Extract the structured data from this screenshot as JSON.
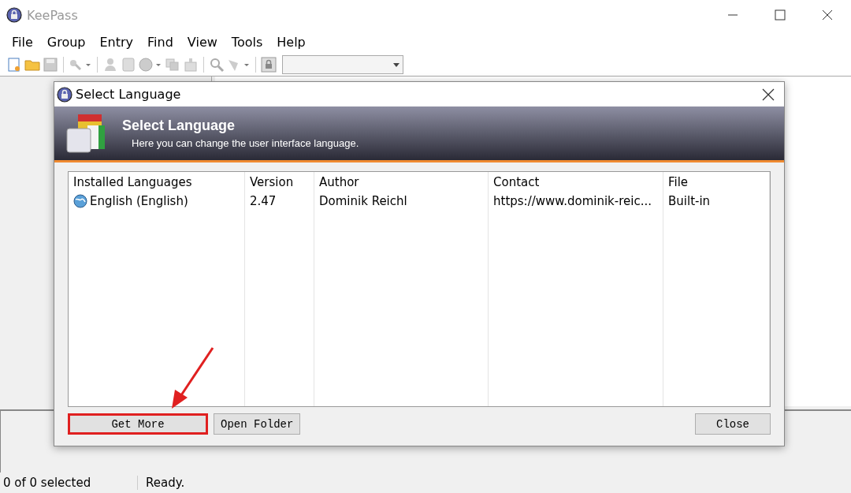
{
  "window": {
    "title": "KeePass"
  },
  "menu": [
    "File",
    "Group",
    "Entry",
    "Find",
    "View",
    "Tools",
    "Help"
  ],
  "dialog": {
    "title": "Select Language",
    "banner_title": "Select Language",
    "banner_subtitle": "Here you can change the user interface language.",
    "columns": [
      "Installed Languages",
      "Version",
      "Author",
      "Contact",
      "File"
    ],
    "rows": [
      {
        "cells": [
          "English (English)",
          "2.47",
          "Dominik Reichl",
          "https://www.dominik-reic...",
          "Built-in"
        ]
      }
    ],
    "buttons": [
      {
        "label": "Get More",
        "highlighted": true
      },
      {
        "label": "Open Folder",
        "highlighted": false
      },
      {
        "label": "Close",
        "highlighted": false
      }
    ]
  },
  "status_bar": [
    "0 of 0 selected",
    "Ready."
  ]
}
